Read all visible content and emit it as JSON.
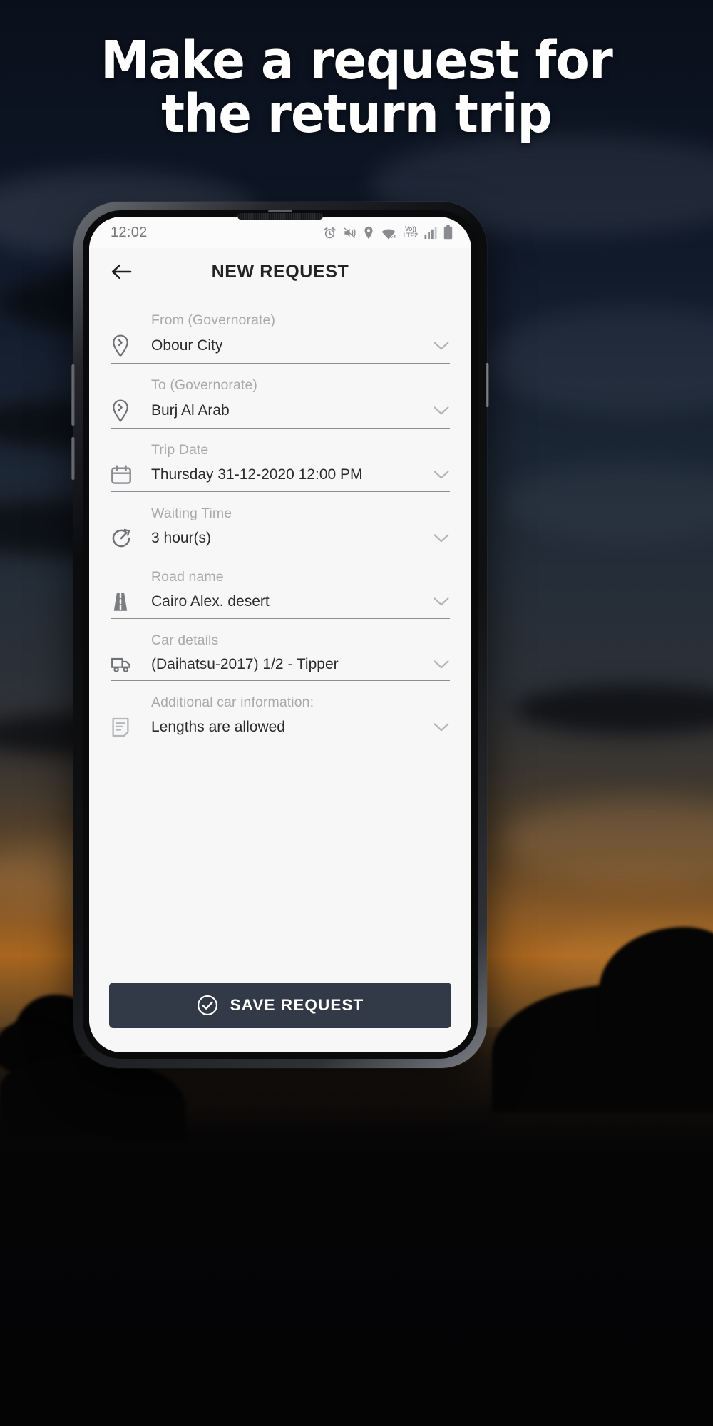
{
  "promo": {
    "headline_line1": "Make a request for",
    "headline_line2": "the return trip"
  },
  "phone": {
    "status_bar": {
      "time": "12:02",
      "icons": [
        "alarm-clock-icon",
        "vibrate-icon",
        "location-icon",
        "wifi-icon",
        "volte-lte2-label",
        "signal-bars-icon",
        "battery-icon"
      ],
      "network_label_top": "Vo))",
      "network_label_bottom": "LTE2"
    },
    "appbar": {
      "back_icon": "arrow-left-icon",
      "title": "NEW REQUEST"
    },
    "form": {
      "fields": [
        {
          "label": "From (Governorate)",
          "value": "Obour City",
          "icon": "location-pin-icon",
          "chevron": "chevron-down-icon"
        },
        {
          "label": "To (Governorate)",
          "value": "Burj Al Arab",
          "icon": "location-pin-icon",
          "chevron": "chevron-down-icon"
        },
        {
          "label": "Trip Date",
          "value": "Thursday 31-12-2020   12:00 PM",
          "icon": "calendar-icon",
          "chevron": "chevron-down-icon"
        },
        {
          "label": "Waiting Time",
          "value": "3 hour(s)",
          "icon": "stopwatch-icon",
          "chevron": "chevron-down-icon"
        },
        {
          "label": "Road name",
          "value": "Cairo Alex. desert",
          "icon": "road-icon",
          "chevron": "chevron-down-icon"
        },
        {
          "label": "Car details",
          "value": "(Daihatsu-2017) 1/2 - Tipper",
          "icon": "truck-icon",
          "chevron": "chevron-down-icon"
        },
        {
          "label": "Additional car information:",
          "value": "Lengths are allowed",
          "icon": "note-icon",
          "chevron": "chevron-down-icon"
        }
      ]
    },
    "footer": {
      "save_label": "SAVE REQUEST",
      "save_icon": "check-circle-icon"
    }
  },
  "colors": {
    "promo_background": "#0b1018",
    "screen_background": "#f7f7f7",
    "label_gray": "#a9a9ab",
    "value_dark": "#2b2b2b",
    "underline_gray": "#8e8e8e",
    "button_slate": "#333a47",
    "button_text": "#ffffff",
    "icon_gray": "#6f7175"
  }
}
